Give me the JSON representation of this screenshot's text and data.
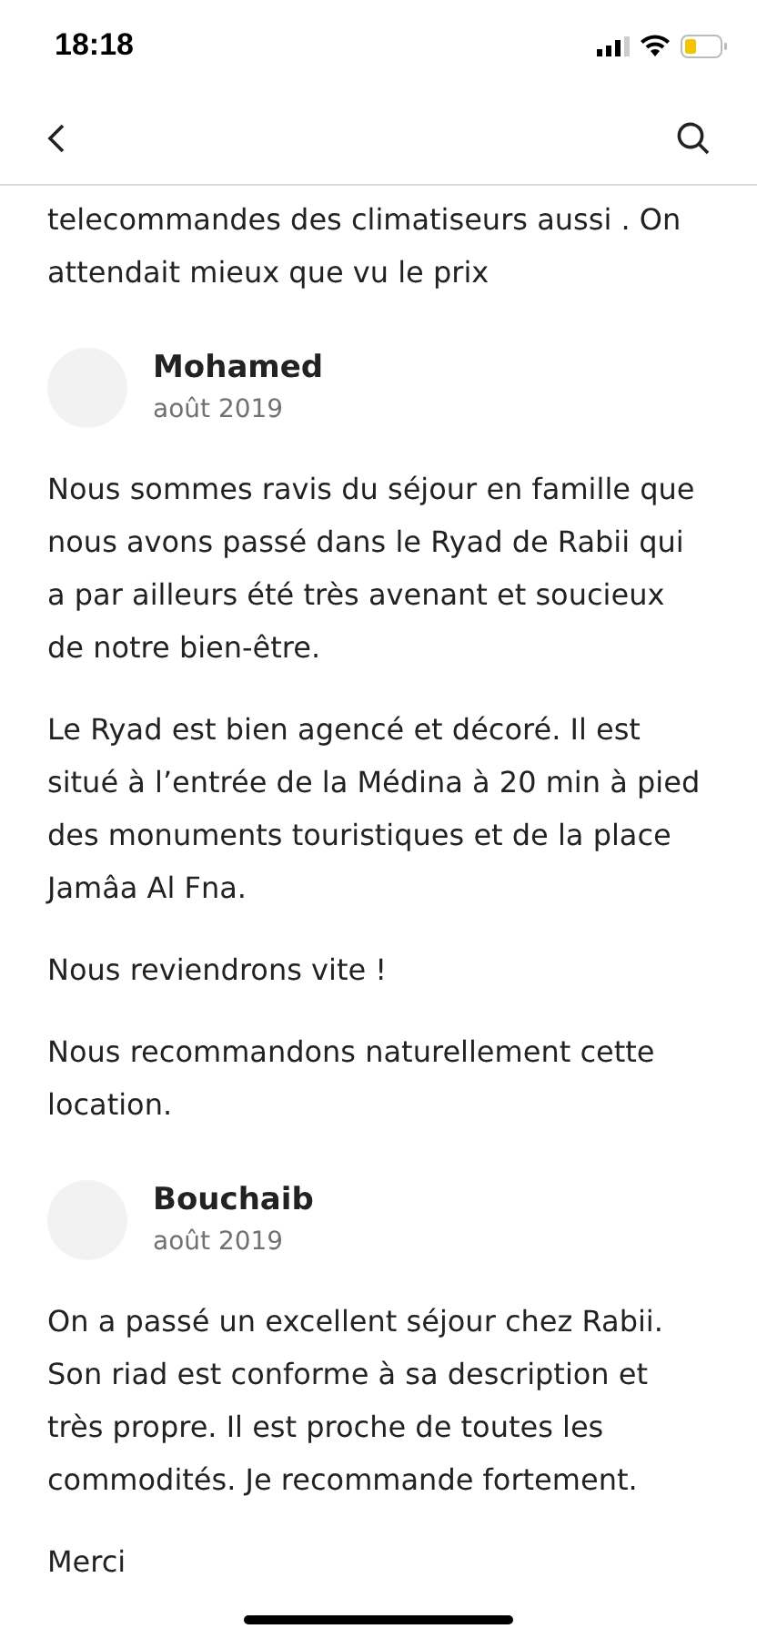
{
  "status_bar": {
    "time": "18:18"
  },
  "previous_review": {
    "paragraphs": [
      "telecommandes des climatiseurs aussi . On attendait mieux que vu le prix"
    ]
  },
  "reviews": [
    {
      "author": "Mohamed",
      "date": "août 2019",
      "paragraphs": [
        "Nous sommes ravis du séjour en famille que nous avons passé dans le Ryad de Rabii qui a par ailleurs été très avenant et soucieux de notre bien-être.",
        "Le Ryad est bien agencé et décoré. Il est situé à l’entrée de la Médina à 20 min à pied des monuments touristiques et de la place Jamâa Al Fna.",
        "Nous reviendrons vite !",
        "Nous recommandons naturellement cette location."
      ]
    },
    {
      "author": "Bouchaib",
      "date": "août 2019",
      "paragraphs": [
        "On a passé un excellent séjour chez Rabii. Son riad est conforme à sa description et très propre. Il est proche de toutes les commodités. Je recommande fortement.",
        "Merci"
      ]
    }
  ]
}
